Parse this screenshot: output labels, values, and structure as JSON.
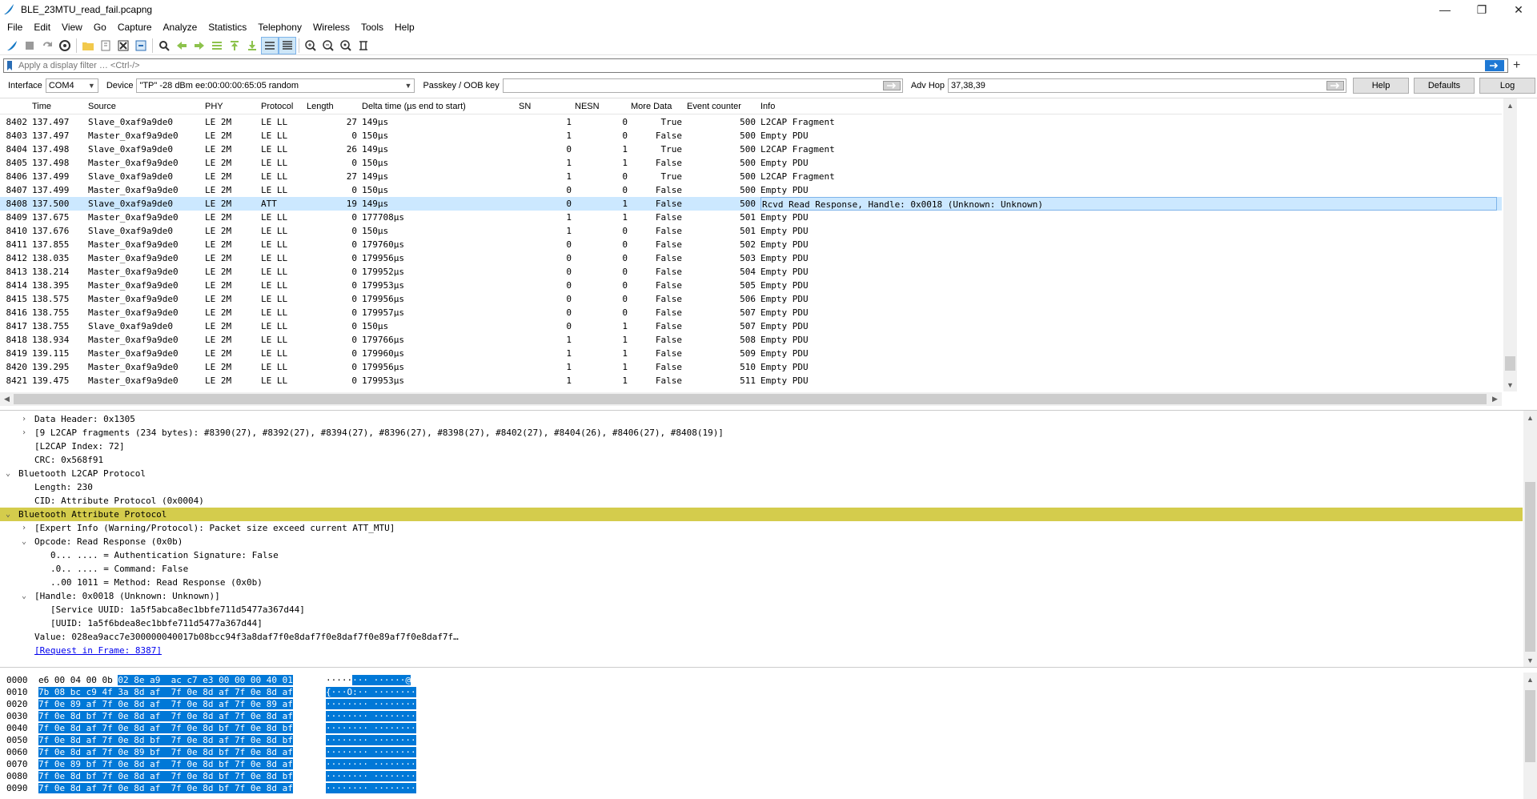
{
  "window": {
    "title": "BLE_23MTU_read_fail.pcapng",
    "minimize": "—",
    "maximize": "❐",
    "close": "✕"
  },
  "menu": [
    "File",
    "Edit",
    "View",
    "Go",
    "Capture",
    "Analyze",
    "Statistics",
    "Telephony",
    "Wireless",
    "Tools",
    "Help"
  ],
  "filter": {
    "placeholder": "Apply a display filter … <Ctrl-/>",
    "plus": "+"
  },
  "sniffer": {
    "interface_label": "Interface",
    "interface_value": "COM4",
    "device_label": "Device",
    "device_value": "\"TP\"  -28 dBm  ee:00:00:00:65:05  random",
    "passkey_label": "Passkey / OOB key",
    "passkey_value": "",
    "advhop_label": "Adv Hop",
    "advhop_value": "37,38,39",
    "help": "Help",
    "defaults": "Defaults",
    "log": "Log"
  },
  "columns": [
    "Time",
    "Source",
    "PHY",
    "Protocol",
    "Length",
    "Delta time (µs end to start)",
    "SN",
    "NESN",
    "More Data",
    "Event counter",
    "Info"
  ],
  "packets": [
    {
      "no": "8402",
      "time": "137.497",
      "src": "Slave_0xaf9a9de0",
      "phy": "LE 2M",
      "proto": "LE LL",
      "len": "27",
      "delta": "149µs",
      "sn": "1",
      "nesn": "0",
      "md": "True",
      "ev": "500",
      "info": "L2CAP Fragment"
    },
    {
      "no": "8403",
      "time": "137.497",
      "src": "Master_0xaf9a9de0",
      "phy": "LE 2M",
      "proto": "LE LL",
      "len": "0",
      "delta": "150µs",
      "sn": "1",
      "nesn": "0",
      "md": "False",
      "ev": "500",
      "info": "Empty PDU"
    },
    {
      "no": "8404",
      "time": "137.498",
      "src": "Slave_0xaf9a9de0",
      "phy": "LE 2M",
      "proto": "LE LL",
      "len": "26",
      "delta": "149µs",
      "sn": "0",
      "nesn": "1",
      "md": "True",
      "ev": "500",
      "info": "L2CAP Fragment"
    },
    {
      "no": "8405",
      "time": "137.498",
      "src": "Master_0xaf9a9de0",
      "phy": "LE 2M",
      "proto": "LE LL",
      "len": "0",
      "delta": "150µs",
      "sn": "1",
      "nesn": "1",
      "md": "False",
      "ev": "500",
      "info": "Empty PDU"
    },
    {
      "no": "8406",
      "time": "137.499",
      "src": "Slave_0xaf9a9de0",
      "phy": "LE 2M",
      "proto": "LE LL",
      "len": "27",
      "delta": "149µs",
      "sn": "1",
      "nesn": "0",
      "md": "True",
      "ev": "500",
      "info": "L2CAP Fragment"
    },
    {
      "no": "8407",
      "time": "137.499",
      "src": "Master_0xaf9a9de0",
      "phy": "LE 2M",
      "proto": "LE LL",
      "len": "0",
      "delta": "150µs",
      "sn": "0",
      "nesn": "0",
      "md": "False",
      "ev": "500",
      "info": "Empty PDU"
    },
    {
      "no": "8408",
      "time": "137.500",
      "src": "Slave_0xaf9a9de0",
      "phy": "LE 2M",
      "proto": "ATT",
      "len": "19",
      "delta": "149µs",
      "sn": "0",
      "nesn": "1",
      "md": "False",
      "ev": "500",
      "info": "Rcvd Read Response, Handle: 0x0018 (Unknown: Unknown)",
      "selected": true
    },
    {
      "no": "8409",
      "time": "137.675",
      "src": "Master_0xaf9a9de0",
      "phy": "LE 2M",
      "proto": "LE LL",
      "len": "0",
      "delta": "177708µs",
      "sn": "1",
      "nesn": "1",
      "md": "False",
      "ev": "501",
      "info": "Empty PDU"
    },
    {
      "no": "8410",
      "time": "137.676",
      "src": "Slave_0xaf9a9de0",
      "phy": "LE 2M",
      "proto": "LE LL",
      "len": "0",
      "delta": "150µs",
      "sn": "1",
      "nesn": "0",
      "md": "False",
      "ev": "501",
      "info": "Empty PDU"
    },
    {
      "no": "8411",
      "time": "137.855",
      "src": "Master_0xaf9a9de0",
      "phy": "LE 2M",
      "proto": "LE LL",
      "len": "0",
      "delta": "179760µs",
      "sn": "0",
      "nesn": "0",
      "md": "False",
      "ev": "502",
      "info": "Empty PDU"
    },
    {
      "no": "8412",
      "time": "138.035",
      "src": "Master_0xaf9a9de0",
      "phy": "LE 2M",
      "proto": "LE LL",
      "len": "0",
      "delta": "179956µs",
      "sn": "0",
      "nesn": "0",
      "md": "False",
      "ev": "503",
      "info": "Empty PDU"
    },
    {
      "no": "8413",
      "time": "138.214",
      "src": "Master_0xaf9a9de0",
      "phy": "LE 2M",
      "proto": "LE LL",
      "len": "0",
      "delta": "179952µs",
      "sn": "0",
      "nesn": "0",
      "md": "False",
      "ev": "504",
      "info": "Empty PDU"
    },
    {
      "no": "8414",
      "time": "138.395",
      "src": "Master_0xaf9a9de0",
      "phy": "LE 2M",
      "proto": "LE LL",
      "len": "0",
      "delta": "179953µs",
      "sn": "0",
      "nesn": "0",
      "md": "False",
      "ev": "505",
      "info": "Empty PDU"
    },
    {
      "no": "8415",
      "time": "138.575",
      "src": "Master_0xaf9a9de0",
      "phy": "LE 2M",
      "proto": "LE LL",
      "len": "0",
      "delta": "179956µs",
      "sn": "0",
      "nesn": "0",
      "md": "False",
      "ev": "506",
      "info": "Empty PDU"
    },
    {
      "no": "8416",
      "time": "138.755",
      "src": "Master_0xaf9a9de0",
      "phy": "LE 2M",
      "proto": "LE LL",
      "len": "0",
      "delta": "179957µs",
      "sn": "0",
      "nesn": "0",
      "md": "False",
      "ev": "507",
      "info": "Empty PDU"
    },
    {
      "no": "8417",
      "time": "138.755",
      "src": "Slave_0xaf9a9de0",
      "phy": "LE 2M",
      "proto": "LE LL",
      "len": "0",
      "delta": "150µs",
      "sn": "0",
      "nesn": "1",
      "md": "False",
      "ev": "507",
      "info": "Empty PDU"
    },
    {
      "no": "8418",
      "time": "138.934",
      "src": "Master_0xaf9a9de0",
      "phy": "LE 2M",
      "proto": "LE LL",
      "len": "0",
      "delta": "179766µs",
      "sn": "1",
      "nesn": "1",
      "md": "False",
      "ev": "508",
      "info": "Empty PDU"
    },
    {
      "no": "8419",
      "time": "139.115",
      "src": "Master_0xaf9a9de0",
      "phy": "LE 2M",
      "proto": "LE LL",
      "len": "0",
      "delta": "179960µs",
      "sn": "1",
      "nesn": "1",
      "md": "False",
      "ev": "509",
      "info": "Empty PDU"
    },
    {
      "no": "8420",
      "time": "139.295",
      "src": "Master_0xaf9a9de0",
      "phy": "LE 2M",
      "proto": "LE LL",
      "len": "0",
      "delta": "179956µs",
      "sn": "1",
      "nesn": "1",
      "md": "False",
      "ev": "510",
      "info": "Empty PDU"
    },
    {
      "no": "8421",
      "time": "139.475",
      "src": "Master_0xaf9a9de0",
      "phy": "LE 2M",
      "proto": "LE LL",
      "len": "0",
      "delta": "179953µs",
      "sn": "1",
      "nesn": "1",
      "md": "False",
      "ev": "511",
      "info": "Empty PDU"
    }
  ],
  "details": [
    {
      "indent": 1,
      "arrow": "collapsed",
      "text": "Data Header: 0x1305"
    },
    {
      "indent": 1,
      "arrow": "collapsed",
      "text": "[9 L2CAP fragments (234 bytes): #8390(27), #8392(27), #8394(27), #8396(27), #8398(27), #8402(27), #8404(26), #8406(27), #8408(19)]"
    },
    {
      "indent": 1,
      "arrow": "none",
      "text": "[L2CAP Index: 72]"
    },
    {
      "indent": 1,
      "arrow": "none",
      "text": "CRC: 0x568f91"
    },
    {
      "indent": 0,
      "arrow": "expanded",
      "text": "Bluetooth L2CAP Protocol"
    },
    {
      "indent": 1,
      "arrow": "none",
      "text": "Length: 230"
    },
    {
      "indent": 1,
      "arrow": "none",
      "text": "CID: Attribute Protocol (0x0004)"
    },
    {
      "indent": 0,
      "arrow": "expanded",
      "text": "Bluetooth Attribute Protocol",
      "highlight": true
    },
    {
      "indent": 1,
      "arrow": "collapsed",
      "text": "[Expert Info (Warning/Protocol): Packet size exceed current ATT_MTU]"
    },
    {
      "indent": 1,
      "arrow": "expanded",
      "text": "Opcode: Read Response (0x0b)"
    },
    {
      "indent": 2,
      "arrow": "none",
      "text": "0... .... = Authentication Signature: False"
    },
    {
      "indent": 2,
      "arrow": "none",
      "text": ".0.. .... = Command: False"
    },
    {
      "indent": 2,
      "arrow": "none",
      "text": "..00 1011 = Method: Read Response (0x0b)"
    },
    {
      "indent": 1,
      "arrow": "expanded",
      "text": "[Handle: 0x0018 (Unknown: Unknown)]"
    },
    {
      "indent": 2,
      "arrow": "none",
      "text": "[Service UUID: 1a5f5abca8ec1bbfe711d5477a367d44]"
    },
    {
      "indent": 2,
      "arrow": "none",
      "text": "[UUID: 1a5f6bdea8ec1bbfe711d5477a367d44]"
    },
    {
      "indent": 1,
      "arrow": "none",
      "text": "Value: 028ea9acc7e300000040017b08bcc94f3a8daf7f0e8daf7f0e8daf7f0e89af7f0e8daf7f…"
    },
    {
      "indent": 1,
      "arrow": "none",
      "text": "[Request in Frame: 8387]",
      "link": true
    }
  ],
  "bytes": [
    {
      "off": "0000",
      "hex_plain": "e6 00 04 00 0b ",
      "hex_sel": "02 8e a9  ac c7 e3 00 00 00 40 01",
      "ascii_plain": "·····",
      "ascii_sel": "··· ······@"
    },
    {
      "off": "0010",
      "hex_plain": "",
      "hex_sel": "7b 08 bc c9 4f 3a 8d af  7f 0e 8d af 7f 0e 8d af",
      "ascii_plain": "",
      "ascii_sel": "{···O:·· ········"
    },
    {
      "off": "0020",
      "hex_plain": "",
      "hex_sel": "7f 0e 89 af 7f 0e 8d af  7f 0e 8d af 7f 0e 89 af",
      "ascii_plain": "",
      "ascii_sel": "········ ········"
    },
    {
      "off": "0030",
      "hex_plain": "",
      "hex_sel": "7f 0e 8d bf 7f 0e 8d af  7f 0e 8d af 7f 0e 8d af",
      "ascii_plain": "",
      "ascii_sel": "········ ········"
    },
    {
      "off": "0040",
      "hex_plain": "",
      "hex_sel": "7f 0e 8d af 7f 0e 8d af  7f 0e 8d bf 7f 0e 8d bf",
      "ascii_plain": "",
      "ascii_sel": "········ ········"
    },
    {
      "off": "0050",
      "hex_plain": "",
      "hex_sel": "7f 0e 8d af 7f 0e 8d bf  7f 0e 8d af 7f 0e 8d bf",
      "ascii_plain": "",
      "ascii_sel": "········ ········"
    },
    {
      "off": "0060",
      "hex_plain": "",
      "hex_sel": "7f 0e 8d af 7f 0e 89 bf  7f 0e 8d bf 7f 0e 8d af",
      "ascii_plain": "",
      "ascii_sel": "········ ········"
    },
    {
      "off": "0070",
      "hex_plain": "",
      "hex_sel": "7f 0e 89 bf 7f 0e 8d af  7f 0e 8d bf 7f 0e 8d af",
      "ascii_plain": "",
      "ascii_sel": "········ ········"
    },
    {
      "off": "0080",
      "hex_plain": "",
      "hex_sel": "7f 0e 8d bf 7f 0e 8d af  7f 0e 8d bf 7f 0e 8d bf",
      "ascii_plain": "",
      "ascii_sel": "········ ········"
    },
    {
      "off": "0090",
      "hex_plain": "",
      "hex_sel": "7f 0e 8d af 7f 0e 8d af  7f 0e 8d bf 7f 0e 8d af",
      "ascii_plain": "",
      "ascii_sel": "········ ········"
    }
  ],
  "colors": {
    "selected_row": "#cce8ff",
    "highlight": "#d4cc4c",
    "byte_select": "#0078d7"
  }
}
